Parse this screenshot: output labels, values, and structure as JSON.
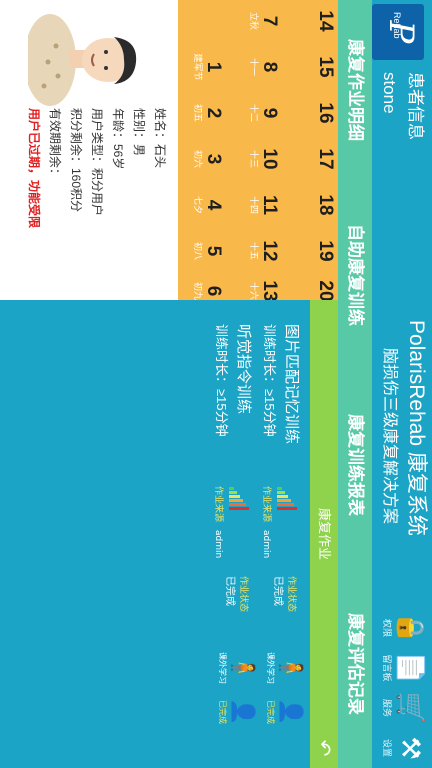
{
  "header": {
    "patient_label": "患者信息",
    "patient_name": "stone",
    "app_title": "PolarisRehab 康复系统",
    "app_subtitle": "脑损伤三级康复解决方案",
    "logo_mark": "P",
    "logo_word": "Rehab",
    "icons": [
      {
        "name": "lock-icon",
        "label": "权限"
      },
      {
        "name": "document-icon",
        "label": "留言板"
      },
      {
        "name": "cart-icon",
        "label": "服务"
      },
      {
        "name": "tools-icon",
        "label": "设置"
      }
    ]
  },
  "nav": [
    "康复作业明细",
    "自助康复训练",
    "康复训练报表",
    "康复评估记录"
  ],
  "calendar": [
    {
      "d": "1",
      "s": "建军节"
    },
    {
      "d": "2",
      "s": "初五"
    },
    {
      "d": "3",
      "s": "初六"
    },
    {
      "d": "4",
      "s": "七夕"
    },
    {
      "d": "5",
      "s": "初八"
    },
    {
      "d": "6",
      "s": "初九"
    },
    {
      "d": "7",
      "s": "立秋"
    },
    {
      "d": "8",
      "s": "十一"
    },
    {
      "d": "9",
      "s": "十二"
    },
    {
      "d": "10",
      "s": "十三"
    },
    {
      "d": "11",
      "s": "十四"
    },
    {
      "d": "12",
      "s": "十五"
    },
    {
      "d": "13",
      "s": "十六"
    },
    {
      "d": "14",
      "s": ""
    },
    {
      "d": "15",
      "s": ""
    },
    {
      "d": "16",
      "s": ""
    },
    {
      "d": "17",
      "s": ""
    },
    {
      "d": "18",
      "s": ""
    },
    {
      "d": "19",
      "s": ""
    },
    {
      "d": "20",
      "s": ""
    }
  ],
  "profile": {
    "name": "姓名：石头",
    "gender": "性别：男",
    "age": "年龄：56岁",
    "user_type": "用户类型：积分用户",
    "points": "积分剩余：160积分",
    "expiry": "有效期剩余：",
    "warning": "用户已过期，功能受限"
  },
  "tasks": {
    "title": "康复作业",
    "items": [
      {
        "name": "图片匹配记忆训练",
        "duration": "训练时长：≥15分钟",
        "meta_label": "作业来源",
        "meta_value": "admin",
        "status_label": "作业状态",
        "status_value": "已完成",
        "fig1": "课外学习",
        "fig2": "已完成"
      },
      {
        "name": "听觉指令训练",
        "duration": "训练时长：≥15分钟",
        "meta_label": "作业来源",
        "meta_value": "admin",
        "status_label": "作业状态",
        "status_value": "已完成",
        "fig1": "课外学习",
        "fig2": "已完成"
      }
    ]
  },
  "colors": {
    "header": "#1ba4c6",
    "nav": "#58c9a6",
    "calendar": "#f9b84a",
    "task_title": "#8fd24c",
    "warning": "#e02020"
  }
}
